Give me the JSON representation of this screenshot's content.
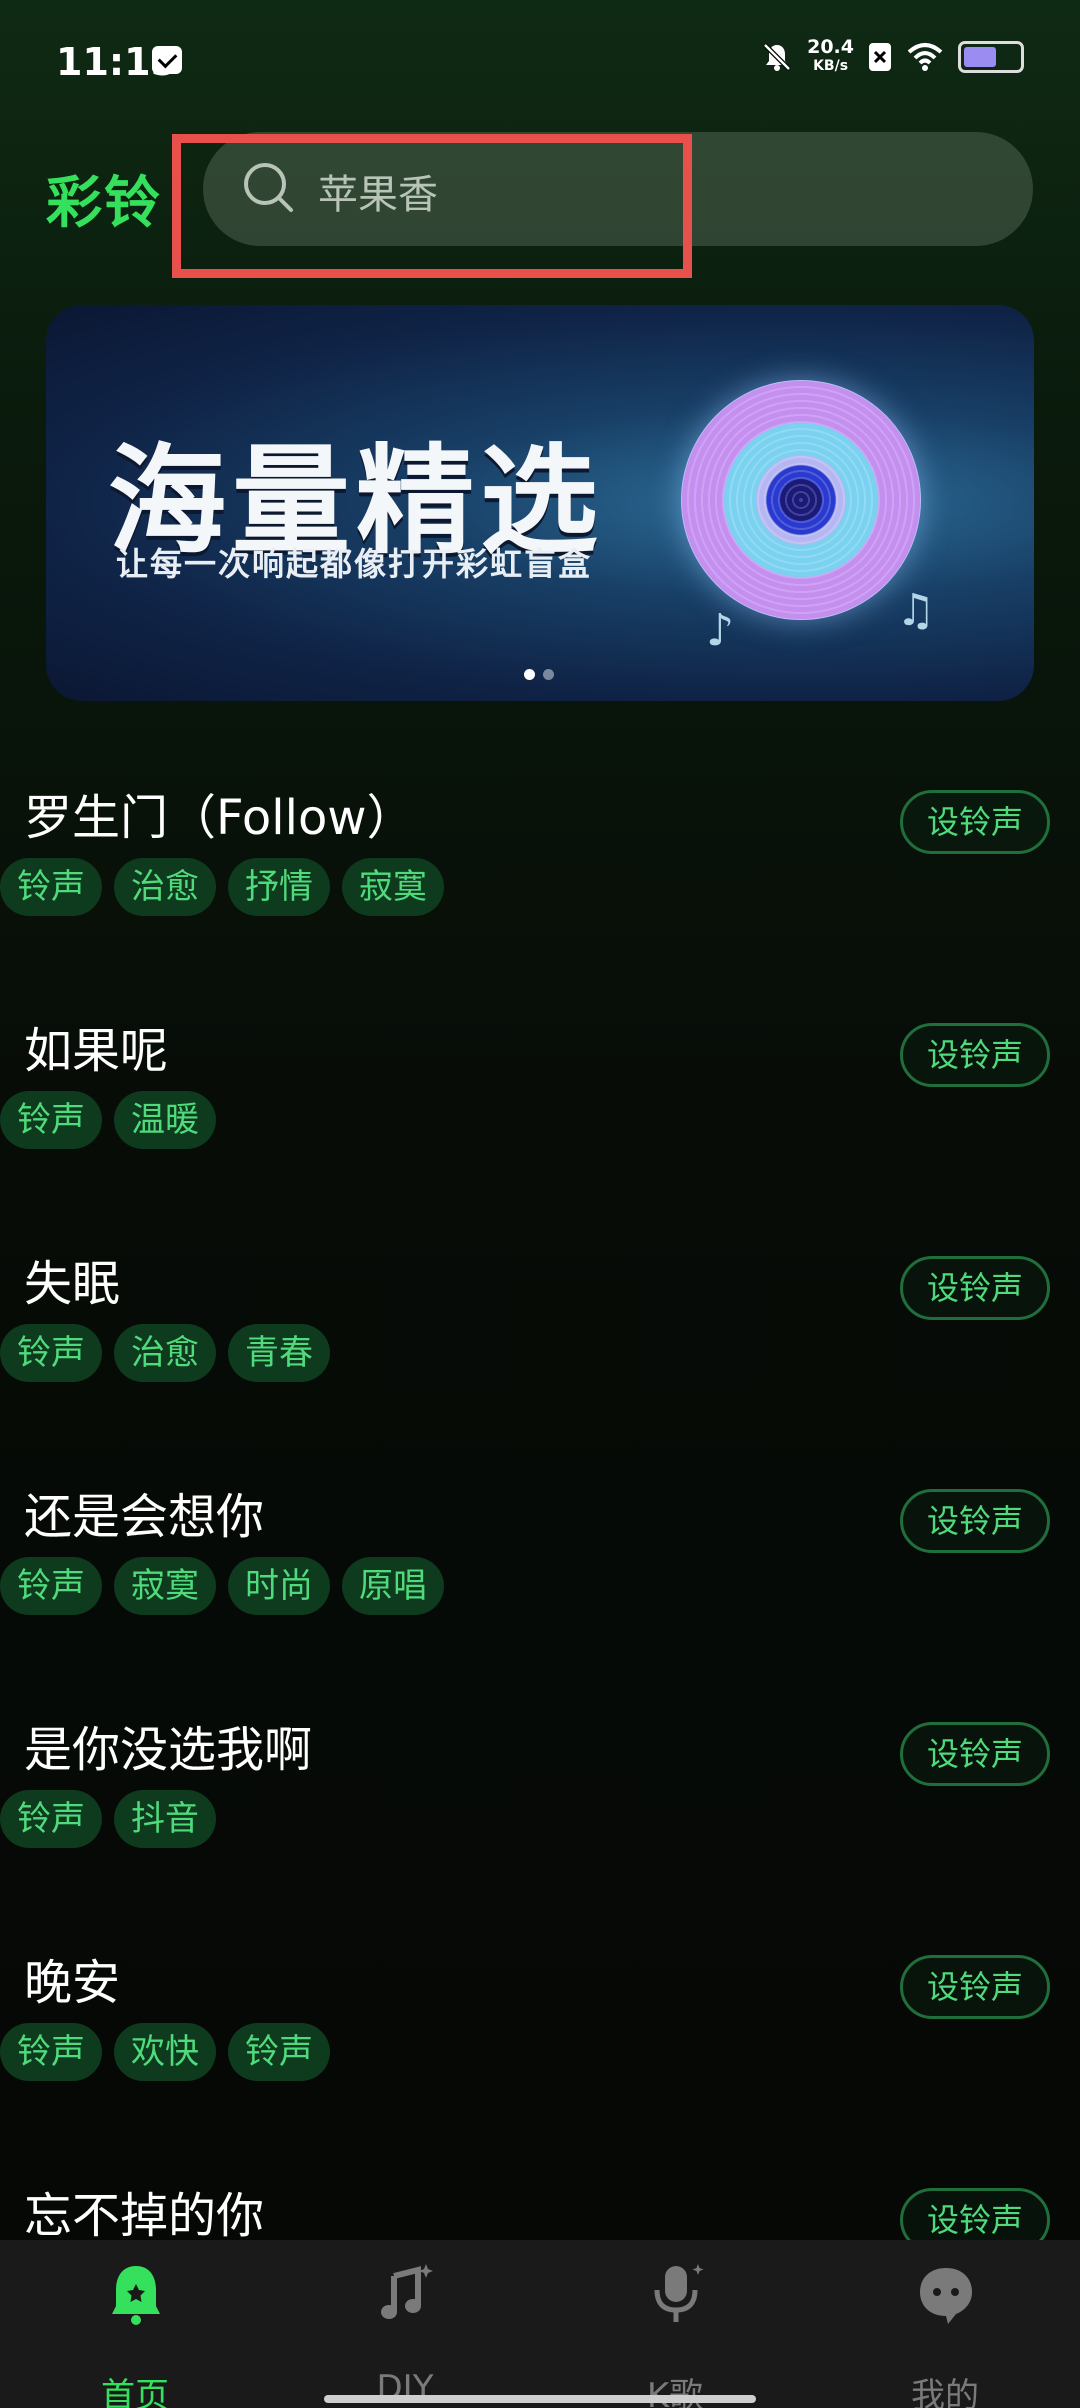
{
  "status_bar": {
    "time": "11:15",
    "network_speed": "20.4",
    "network_unit": "KB/s",
    "icons": [
      "message-icon",
      "mute-icon",
      "sim-icon",
      "wifi-icon",
      "battery-icon"
    ]
  },
  "header": {
    "brand": "彩铃",
    "search_placeholder": "苹果香"
  },
  "banner": {
    "title": "海量精选",
    "subtitle": "让每一次响起都像打开彩虹盲盒",
    "page_count": 2,
    "active_page": 1
  },
  "songs": [
    {
      "title": "罗生门（Follow）",
      "tags": [
        "铃声",
        "治愈",
        "抒情",
        "寂寞"
      ],
      "action": "设铃声"
    },
    {
      "title": "如果呢",
      "tags": [
        "铃声",
        "温暖"
      ],
      "action": "设铃声"
    },
    {
      "title": "失眠",
      "tags": [
        "铃声",
        "治愈",
        "青春"
      ],
      "action": "设铃声"
    },
    {
      "title": "还是会想你",
      "tags": [
        "铃声",
        "寂寞",
        "时尚",
        "原唱"
      ],
      "action": "设铃声"
    },
    {
      "title": "是你没选我啊",
      "tags": [
        "铃声",
        "抖音"
      ],
      "action": "设铃声"
    },
    {
      "title": "晚安",
      "tags": [
        "铃声",
        "欢快",
        "铃声"
      ],
      "action": "设铃声"
    },
    {
      "title": "忘不掉的你",
      "tags": [],
      "action": "设铃声"
    }
  ],
  "bottom_nav": [
    {
      "label": "首页",
      "icon": "bell-icon",
      "active": true
    },
    {
      "label": "DIY",
      "icon": "music-note-icon",
      "active": false
    },
    {
      "label": "K歌",
      "icon": "microphone-icon",
      "active": false
    },
    {
      "label": "我的",
      "icon": "chat-bubble-icon",
      "active": false
    }
  ],
  "colors": {
    "accent": "#35e05c",
    "tag_text": "#4fdb7c",
    "tag_bg": "#0e3a1e",
    "highlight": "#e8504c"
  }
}
